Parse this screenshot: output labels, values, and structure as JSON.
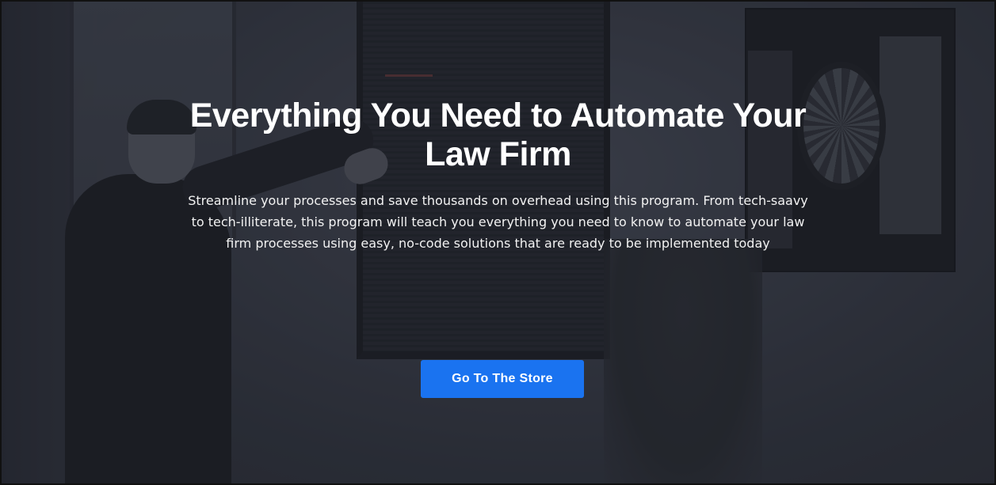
{
  "hero": {
    "headline": "Everything You Need to Automate Your Law Firm",
    "subtext": "Streamline your processes and save thousands on overhead using this program. From tech-saavy to tech-illiterate, this program will teach you everything you need to know to automate your law firm processes using easy, no-code solutions that are ready to be implemented today",
    "cta_label": "Go To The Store"
  },
  "colors": {
    "cta_background": "#1a73f0",
    "overlay": "#21242c",
    "text": "#ffffff"
  }
}
